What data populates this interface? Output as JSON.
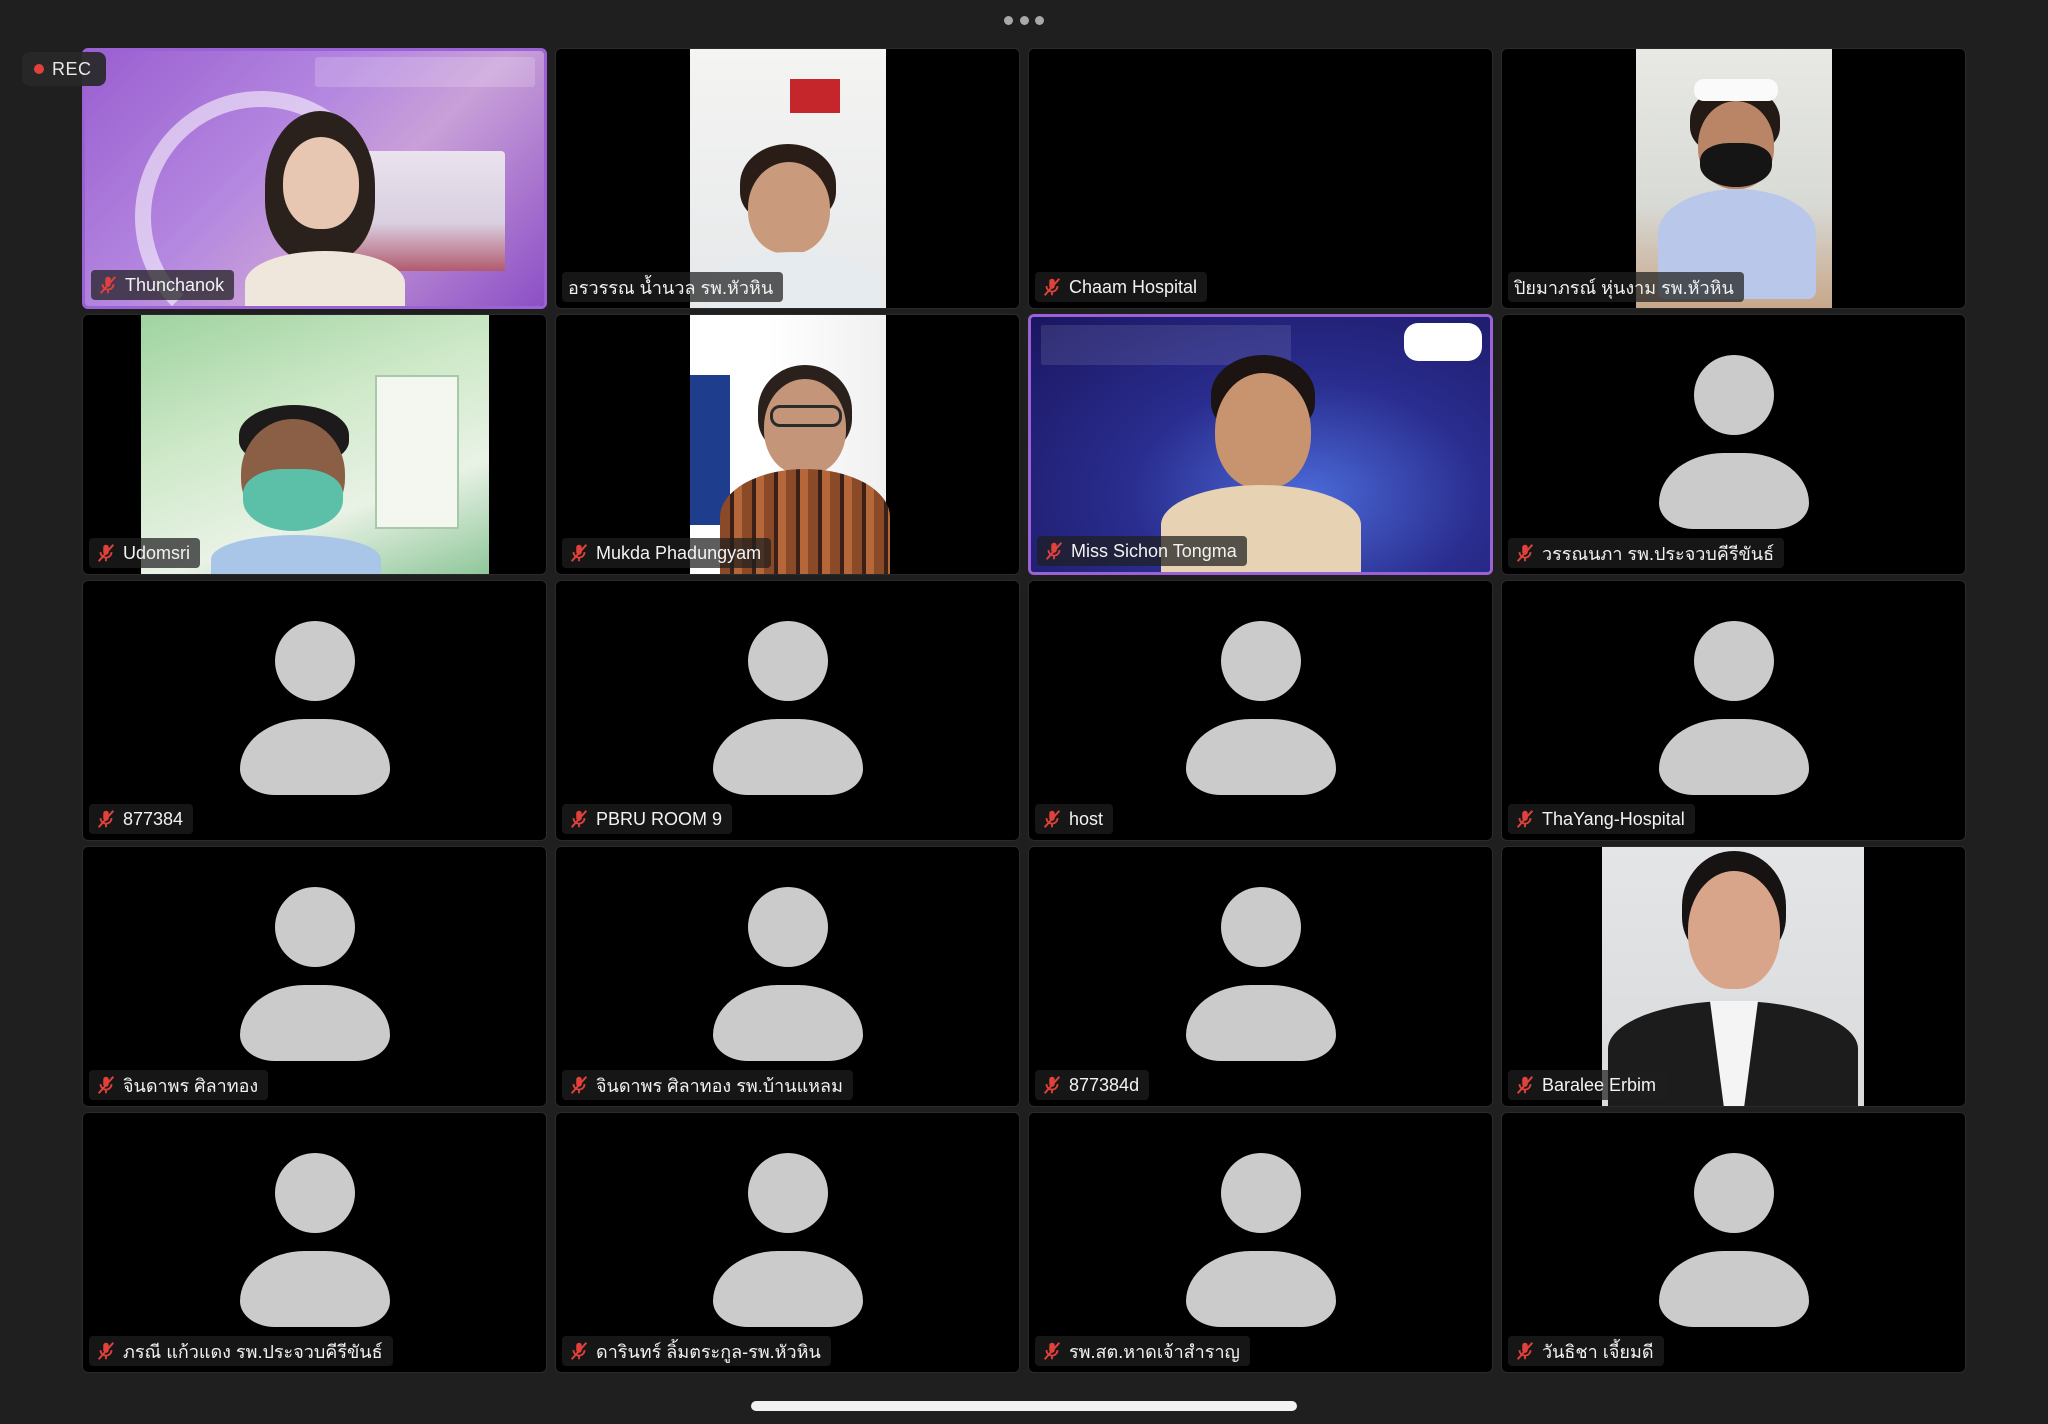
{
  "window": {
    "more_menu_icon": "ellipsis-icon",
    "recording": {
      "label": "REC",
      "dot_color": "#e0423b"
    }
  },
  "speaking_color": "#9b62d6",
  "participants": [
    {
      "name": "Thunchanok",
      "muted": true,
      "video": "purple-background-woman"
    },
    {
      "name": "อรวรรณ น้ำนวล รพ.หัวหิน",
      "muted": false,
      "video": "woman-office"
    },
    {
      "name": "Chaam Hospital",
      "muted": true,
      "video": "black"
    },
    {
      "name": "ปิยมาภรณ์ หุ่นงาม รพ.หัวหิน",
      "muted": false,
      "video": "nurse-masked"
    },
    {
      "name": "Udomsri",
      "muted": true,
      "video": "masked-green-room"
    },
    {
      "name": "Mukda Phadungyam",
      "muted": true,
      "video": "woman-glasses-poster"
    },
    {
      "name": "Miss Sichon Tongma",
      "muted": true,
      "video": "blue-background-woman"
    },
    {
      "name": "วรรณนภา รพ.ประจวบคีรีขันธ์",
      "muted": true,
      "video": "avatar"
    },
    {
      "name": "877384",
      "muted": true,
      "video": "avatar"
    },
    {
      "name": "PBRU ROOM 9",
      "muted": true,
      "video": "avatar"
    },
    {
      "name": "host",
      "muted": true,
      "video": "avatar"
    },
    {
      "name": "ThaYang-Hospital",
      "muted": true,
      "video": "avatar"
    },
    {
      "name": "จินดาพร ศิลาทอง",
      "muted": true,
      "video": "avatar"
    },
    {
      "name": "จินดาพร ศิลาทอง รพ.บ้านแหลม",
      "muted": true,
      "video": "avatar"
    },
    {
      "name": "877384d",
      "muted": true,
      "video": "avatar"
    },
    {
      "name": "Baralee Erbim",
      "muted": true,
      "video": "portrait-photo"
    },
    {
      "name": "ภรณี แก้วแดง รพ.ประจวบคีรีขันธ์",
      "muted": true,
      "video": "avatar"
    },
    {
      "name": "ดารินทร์ ลิ้มตระกูล-รพ.หัวหิน",
      "muted": true,
      "video": "avatar"
    },
    {
      "name": "รพ.สต.หาดเจ้าสำราญ",
      "muted": true,
      "video": "avatar"
    },
    {
      "name": "วันธิชา เจี้ยมดี",
      "muted": true,
      "video": "avatar"
    }
  ],
  "icons": {
    "muted": "mic-off-icon",
    "avatar": "person-silhouette-icon"
  }
}
